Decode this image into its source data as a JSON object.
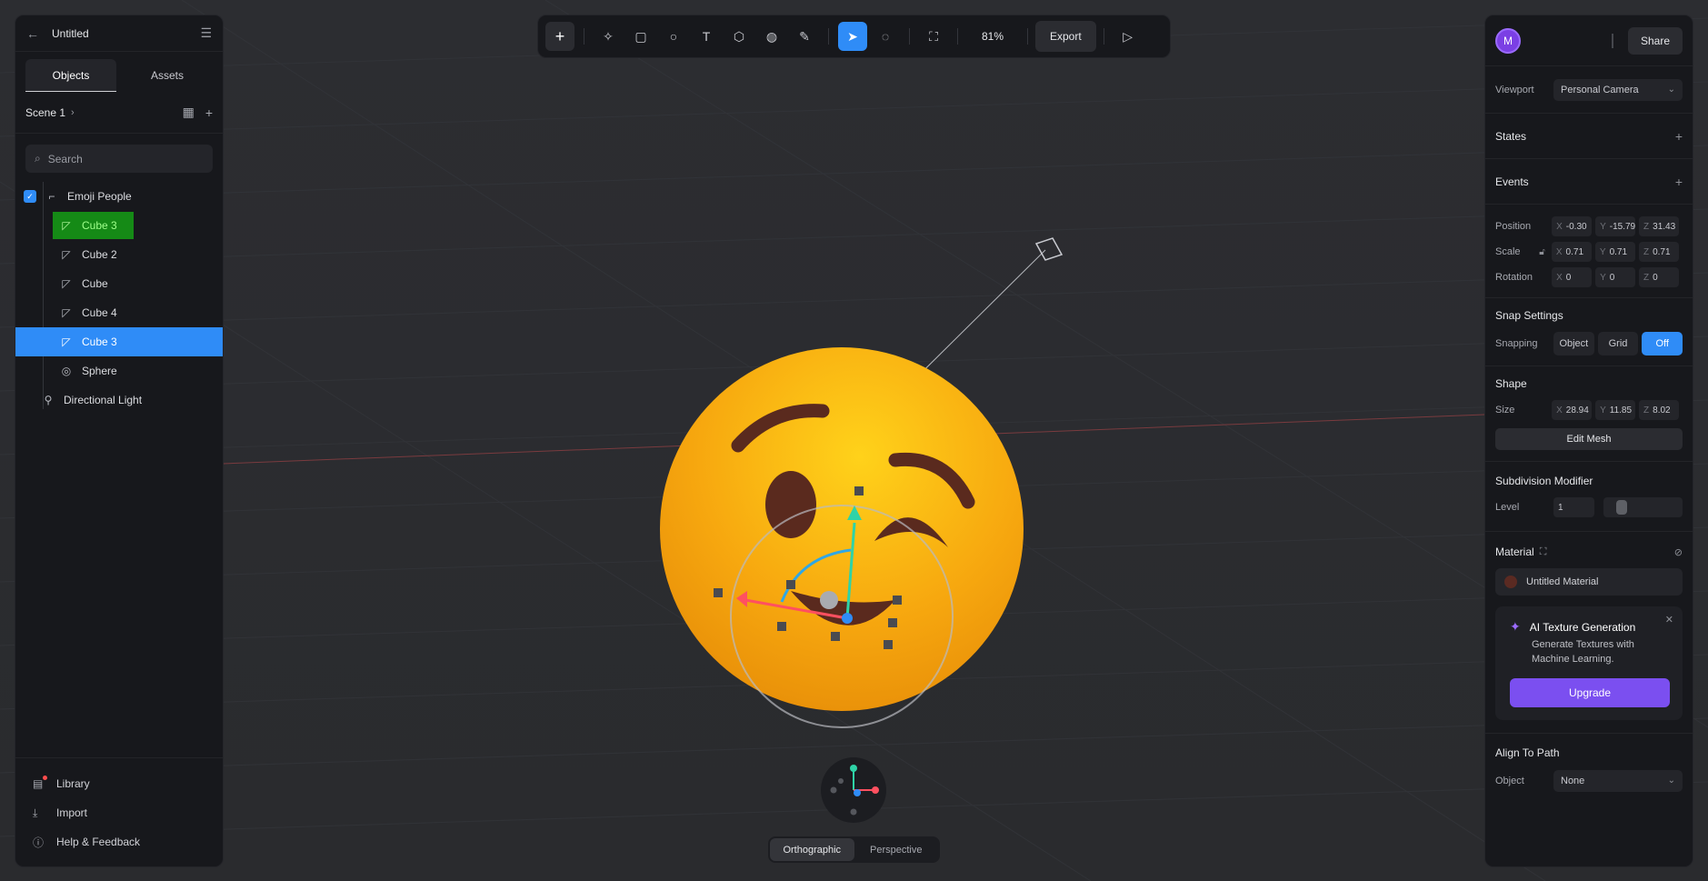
{
  "document": {
    "title": "Untitled"
  },
  "left_panel": {
    "tabs": [
      "Objects",
      "Assets"
    ],
    "scene": "Scene 1",
    "search_placeholder": "Search",
    "tree": [
      {
        "label": "Emoji People",
        "icon": "group-icon",
        "level": 0,
        "checked": true
      },
      {
        "label": "Cube 3",
        "icon": "cube-icon",
        "level": 1,
        "highlight": "green"
      },
      {
        "label": "Cube 2",
        "icon": "cube-icon",
        "level": 1
      },
      {
        "label": "Cube",
        "icon": "cube-icon",
        "level": 1
      },
      {
        "label": "Cube 4",
        "icon": "cube-icon",
        "level": 1
      },
      {
        "label": "Cube 3",
        "icon": "cube-icon",
        "level": 1,
        "selected": true
      },
      {
        "label": "Sphere",
        "icon": "sphere-icon",
        "level": 1
      },
      {
        "label": "Directional Light",
        "icon": "light-icon",
        "level": 0
      }
    ],
    "bottom": [
      "Library",
      "Import",
      "Help & Feedback"
    ]
  },
  "toolbar": {
    "zoom": "81%",
    "export": "Export"
  },
  "right_panel": {
    "avatar_initial": "M",
    "share": "Share",
    "viewport": {
      "label": "Viewport",
      "value": "Personal Camera"
    },
    "states": "States",
    "events": "Events",
    "position": {
      "label": "Position",
      "x": "-0.30",
      "y": "-15.79",
      "z": "31.43"
    },
    "scale": {
      "label": "Scale",
      "x": "0.71",
      "y": "0.71",
      "z": "0.71"
    },
    "rotation": {
      "label": "Rotation",
      "x": "0",
      "y": "0",
      "z": "0"
    },
    "snap": {
      "title": "Snap Settings",
      "label": "Snapping",
      "options": [
        "Object",
        "Grid",
        "Off"
      ],
      "active": "Off"
    },
    "shape": {
      "title": "Shape",
      "size_label": "Size",
      "x": "28.94",
      "y": "11.85",
      "z": "8.02",
      "edit": "Edit Mesh"
    },
    "subdivision": {
      "title": "Subdivision Modifier",
      "level_label": "Level",
      "level": "1"
    },
    "material": {
      "title": "Material",
      "name": "Untitled Material"
    },
    "ai": {
      "title": "AI Texture Generation",
      "desc": "Generate Textures with Machine Learning.",
      "upgrade": "Upgrade"
    },
    "align": {
      "title": "Align To Path",
      "object_label": "Object",
      "object_value": "None"
    }
  },
  "view_toggle": {
    "options": [
      "Orthographic",
      "Perspective"
    ],
    "active": "Orthographic"
  },
  "colors": {
    "accent": "#2f8cf7",
    "emoji": "#f7a80f",
    "upgrade": "#7b4ff0"
  }
}
